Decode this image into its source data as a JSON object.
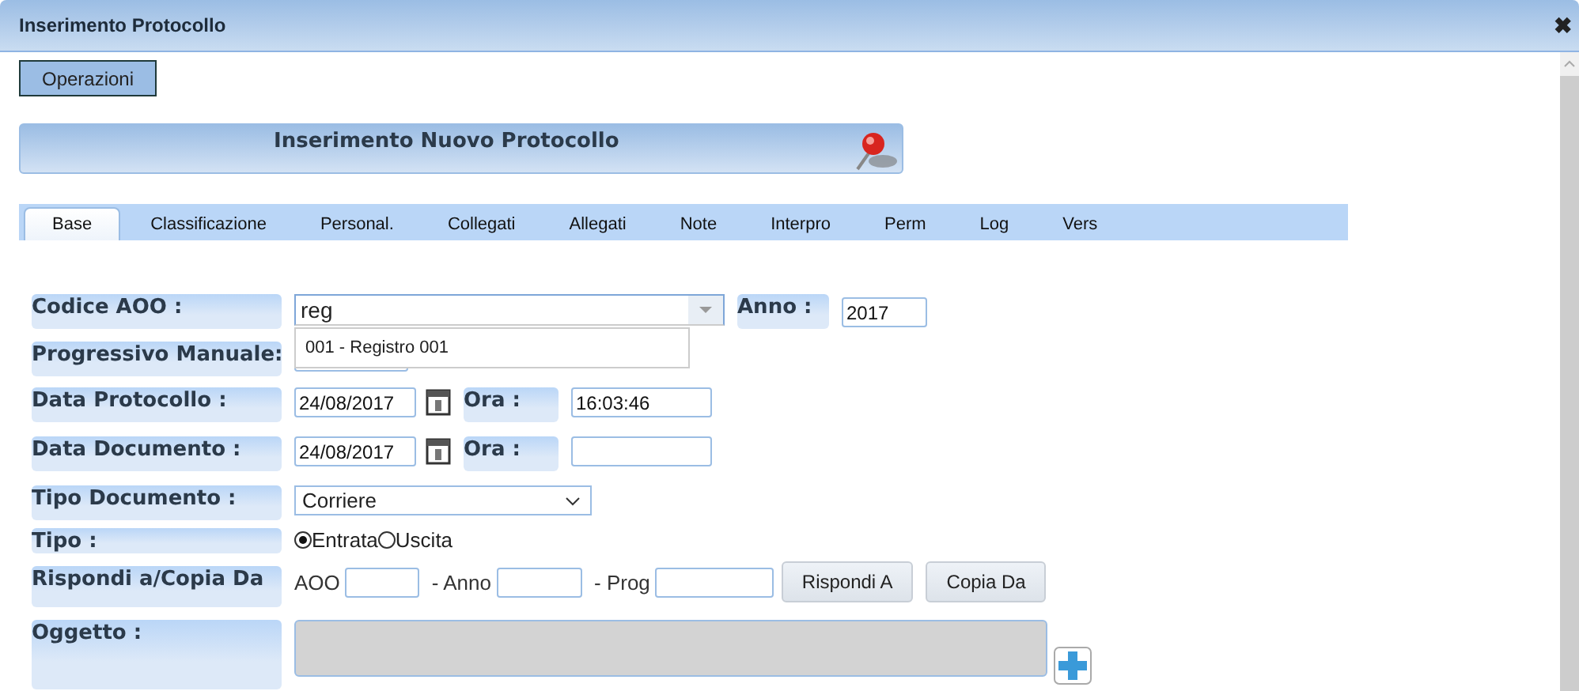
{
  "window": {
    "title": "Inserimento Protocollo",
    "close": "✖"
  },
  "toolbar": {
    "button": "Operazioni"
  },
  "header": {
    "title": "Inserimento Nuovo Protocollo"
  },
  "tabs": [
    {
      "label": "Base",
      "selected": true
    },
    {
      "label": "Classificazione",
      "selected": false
    },
    {
      "label": "Personal.",
      "selected": false
    },
    {
      "label": "Collegati",
      "selected": false
    },
    {
      "label": "Allegati",
      "selected": false
    },
    {
      "label": "Note",
      "selected": false
    },
    {
      "label": "Interpro",
      "selected": false
    },
    {
      "label": "Perm",
      "selected": false
    },
    {
      "label": "Log",
      "selected": false
    },
    {
      "label": "Vers",
      "selected": false
    }
  ],
  "form": {
    "codice_aoo": {
      "label": "Codice AOO :",
      "value": "reg",
      "expanded": true,
      "options": [
        "001 - Registro 001"
      ]
    },
    "anno": {
      "label": "Anno :",
      "value": "2017"
    },
    "progressivo": {
      "label": "Progressivo Manuale:"
    },
    "data_protocollo": {
      "label": "Data Protocollo :",
      "date": "24/08/2017",
      "ora_label": "Ora :",
      "ora": "16:03:46"
    },
    "data_documento": {
      "label": "Data Documento :",
      "date": "24/08/2017",
      "ora_label": "Ora :"
    },
    "tipo_documento": {
      "label": "Tipo Documento :",
      "value": "Corriere"
    },
    "tipo": {
      "label": "Tipo :",
      "options": [
        {
          "label": "Entrata",
          "selected": true
        },
        {
          "label": "Uscita",
          "selected": false
        }
      ]
    },
    "rispondi": {
      "label": "Rispondi a/Copia Da",
      "aoo_label": "AOO",
      "anno_label": "- Anno",
      "prog_label": "- Prog",
      "buttons": [
        "Rispondi A",
        "Copia Da"
      ]
    },
    "oggetto": {
      "label": "Oggetto :",
      "disabled": true
    }
  }
}
